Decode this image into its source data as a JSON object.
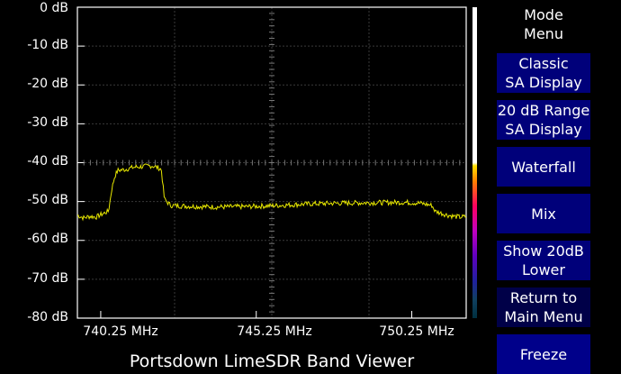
{
  "app": {
    "title": "Portsdown LimeSDR Band Viewer"
  },
  "axes": {
    "y_labels": [
      "0 dB",
      "-10 dB",
      "-20 dB",
      "-30 dB",
      "-40 dB",
      "-50 dB",
      "-60 dB",
      "-70 dB",
      "-80 dB"
    ],
    "x_labels": [
      "740.25 MHz",
      "745.25 MHz",
      "750.25 MHz"
    ]
  },
  "chart_data": {
    "type": "line",
    "title": "",
    "xlabel": "",
    "ylabel": "",
    "xlim": [
      739.5,
      752.0
    ],
    "ylim": [
      -80,
      0
    ],
    "x_ticks": [
      740.25,
      745.25,
      750.25
    ],
    "grid": true,
    "series": [
      {
        "color": "#e8e800",
        "x": [
          739.5,
          739.7,
          739.9,
          740.1,
          740.3,
          740.5,
          740.6,
          740.7,
          740.8,
          741.0,
          741.3,
          741.6,
          741.9,
          742.1,
          742.2,
          742.3,
          742.5,
          743.0,
          744.0,
          745.0,
          746.0,
          747.0,
          748.0,
          749.0,
          750.0,
          750.5,
          750.9,
          751.0,
          751.2,
          751.4,
          751.6,
          751.8,
          752.0
        ],
        "values": [
          -53.5,
          -54.2,
          -53.8,
          -54.0,
          -53.2,
          -52.5,
          -47.0,
          -43.5,
          -42.0,
          -41.8,
          -41.2,
          -41.0,
          -40.8,
          -41.3,
          -41.8,
          -49.5,
          -51.0,
          -51.2,
          -51.4,
          -51.3,
          -51.0,
          -50.6,
          -50.4,
          -50.3,
          -50.2,
          -50.4,
          -51.0,
          -52.5,
          -53.0,
          -53.5,
          -53.8,
          -54.0,
          -53.9
        ]
      }
    ]
  },
  "menu": {
    "title": "Mode\nMenu",
    "buttons": [
      "Classic\nSA Display",
      "20 dB Range\nSA Display",
      "Waterfall",
      "Mix",
      "Show 20dB\nLower",
      "Return to\nMain Menu",
      "Freeze"
    ]
  },
  "colors": {
    "trace": "#e8e800",
    "button": "#00007a",
    "grid": "#555555"
  }
}
